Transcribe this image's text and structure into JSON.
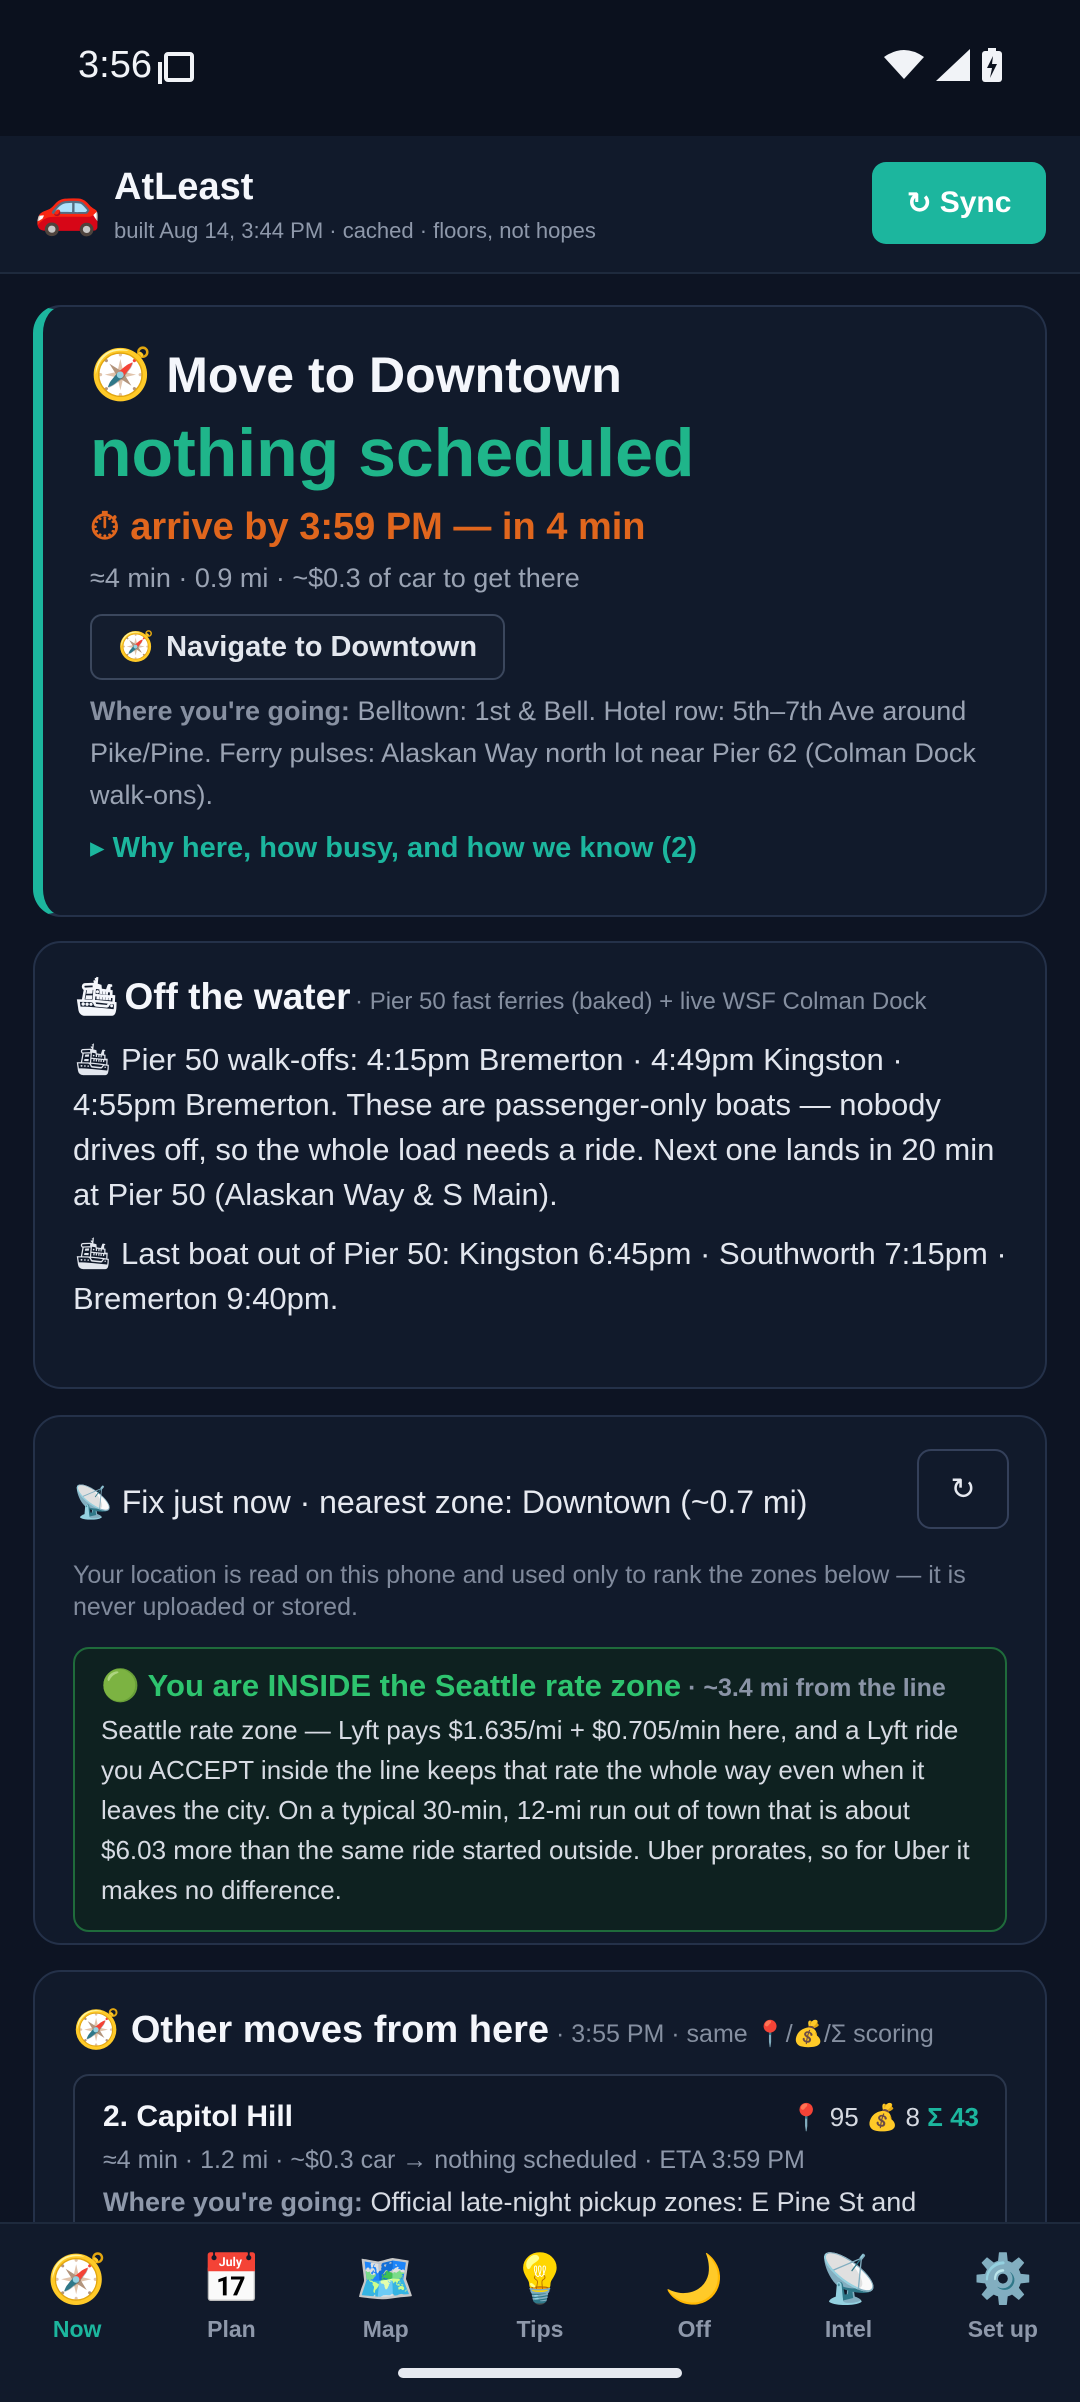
{
  "status_bar": {
    "time": "3:56"
  },
  "header": {
    "logo": "🚗",
    "title": "AtLeast",
    "subtitle": "built Aug 14, 3:44 PM · cached · floors, not hopes",
    "sync_icon": "↻",
    "sync_label": "Sync"
  },
  "now_card": {
    "icon": "🧭",
    "title": "Move to Downtown",
    "status": "nothing scheduled",
    "arrive": "⏱ arrive by 3:59 PM — in 4 min",
    "meta": "≈4 min · 0.9 mi · ~$0.3 of car to get there",
    "navigate_icon": "🧭",
    "navigate_label": "Navigate to Downtown",
    "where_label": "Where you're going:",
    "where_text": " Belltown: 1st & Bell. Hotel row: 5th–7th Ave around Pike/Pine. Ferry pulses: Alaskan Way north lot near Pier 62 (Colman Dock walk-ons).",
    "why_link": "▸ Why here, how busy, and how we know (2)"
  },
  "ferry_card": {
    "icon": "🛳",
    "title": "Off the water",
    "subtitle": " · Pier 50 fast ferries (baked) + live WSF Colman Dock",
    "line1": "🛳 Pier 50 walk-offs: 4:15pm Bremerton · 4:49pm Kingston · 4:55pm Bremerton. These are passenger-only boats — nobody drives off, so the whole load needs a ride. Next one lands in 20 min at Pier 50 (Alaskan Way & S Main).",
    "line2": "🛳 Last boat out of Pier 50: Kingston 6:45pm · Southworth 7:15pm · Bremerton 9:40pm."
  },
  "location_card": {
    "fix": "📡 Fix just now · nearest zone: Downtown (~0.7 mi)",
    "refresh_icon": "↻",
    "note": "Your location is read on this phone and used only to rank the zones below — it is never uploaded or stored.",
    "zone_title": "🟢 You are INSIDE the Seattle rate zone",
    "zone_distance": " · ~3.4 mi from the line",
    "zone_text": "Seattle rate zone — Lyft pays $1.635/mi + $0.705/min here, and a Lyft ride you ACCEPT inside the line keeps that rate the whole way even when it leaves the city. On a typical 30-min, 12-mi run out of town that is about $6.03 more than the same ride started outside. Uber prorates, so for Uber it makes no difference."
  },
  "other_card": {
    "title": "🧭 Other moves from here",
    "subtitle": " · 3:55 PM · same 📍/💰/Σ scoring",
    "moves": [
      {
        "name": "2. Capitol Hill",
        "score_pin": "📍 95",
        "score_money": "💰 8",
        "score_sigma": "Σ 43",
        "meta": "≈4 min · 1.2 mi · ~$0.3 car → nothing scheduled  · ETA 3:59 PM",
        "where_label": "Where you're going:",
        "where_text": " Official late-night pickup zones: E Pine St and"
      }
    ]
  },
  "nav": [
    {
      "icon": "🧭",
      "label": "Now"
    },
    {
      "icon": "📅",
      "label": "Plan"
    },
    {
      "icon": "🗺️",
      "label": "Map"
    },
    {
      "icon": "💡",
      "label": "Tips"
    },
    {
      "icon": "🌙",
      "label": "Off"
    },
    {
      "icon": "📡",
      "label": "Intel"
    },
    {
      "icon": "⚙️",
      "label": "Set up"
    }
  ],
  "colors": {
    "accent": "#1cb69e",
    "status_green": "#1fb58a",
    "arrive_orange": "#e0661d",
    "zone_green": "#2ec46f"
  }
}
